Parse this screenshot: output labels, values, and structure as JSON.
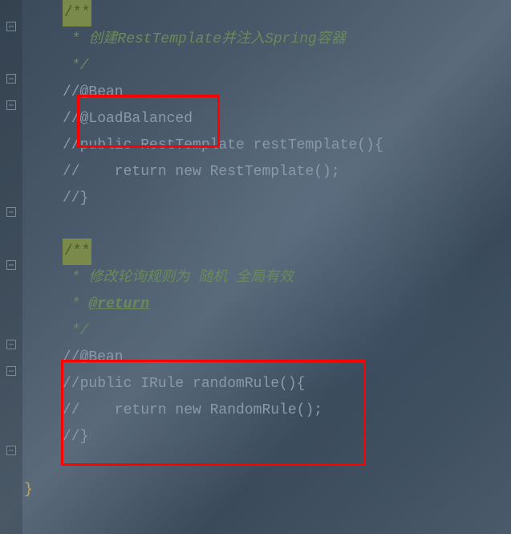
{
  "code": {
    "line1": "/**",
    "line2_prefix": " * ",
    "line2_text": "创建RestTemplate并注入Spring容器",
    "line3": " */",
    "line4": "//@Bean",
    "line5": "//@LoadBalanced",
    "line6": "//public RestTemplate restTemplate(){",
    "line7": "//    return new RestTemplate();",
    "line8": "//}",
    "line9": "",
    "line10": "/**",
    "line11_prefix": " * ",
    "line11_text": "修改轮询规则为 随机 全局有效",
    "line12_prefix": " * ",
    "line12_tag": "@return",
    "line13": " */",
    "line14": "//@Bean",
    "line15": "//public IRule randomRule(){",
    "line16": "//    return new RandomRule();",
    "line17": "//}",
    "line18": "",
    "line19": "}"
  }
}
